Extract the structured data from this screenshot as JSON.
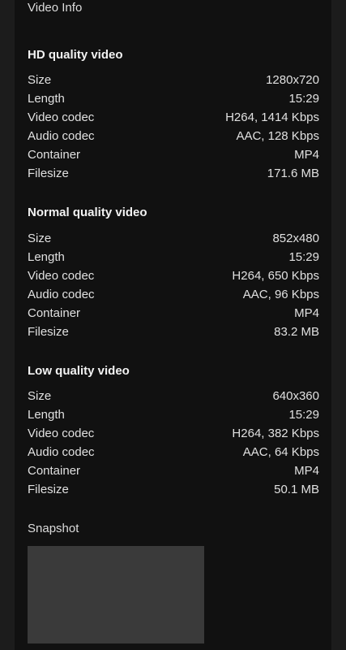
{
  "video_info_label": "Video Info",
  "labels": {
    "size": "Size",
    "length": "Length",
    "video_codec": "Video codec",
    "audio_codec": "Audio codec",
    "container": "Container",
    "filesize": "Filesize"
  },
  "hd": {
    "title": "HD quality video",
    "size": "1280x720",
    "length": "15:29",
    "video_codec": "H264, 1414 Kbps",
    "audio_codec": "AAC, 128 Kbps",
    "container": "MP4",
    "filesize": "171.6 MB"
  },
  "normal": {
    "title": "Normal quality video",
    "size": "852x480",
    "length": "15:29",
    "video_codec": "H264, 650 Kbps",
    "audio_codec": "AAC, 96 Kbps",
    "container": "MP4",
    "filesize": "83.2 MB"
  },
  "low": {
    "title": "Low quality video",
    "size": "640x360",
    "length": "15:29",
    "video_codec": "H264, 382 Kbps",
    "audio_codec": "AAC, 64 Kbps",
    "container": "MP4",
    "filesize": "50.1 MB"
  },
  "snapshot_label": "Snapshot"
}
